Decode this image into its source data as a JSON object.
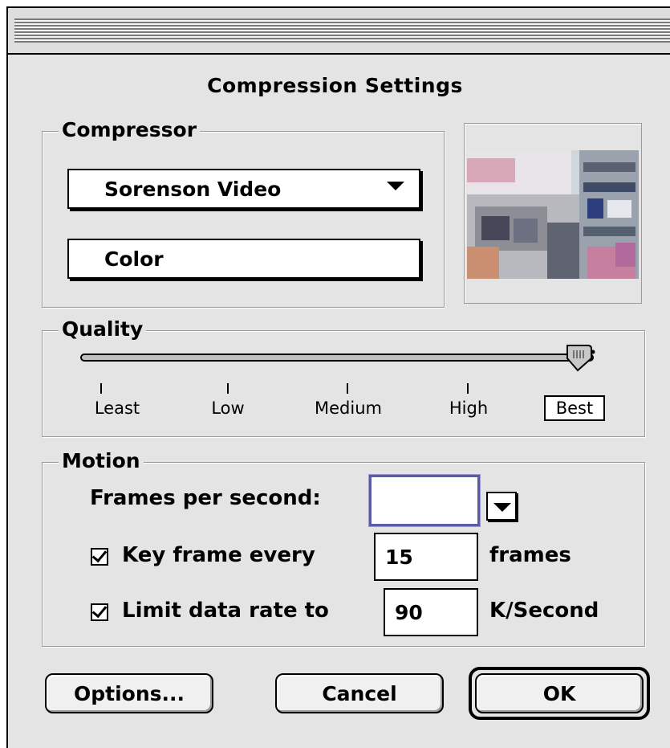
{
  "dialog": {
    "title": "Compression Settings"
  },
  "compressor": {
    "group_label": "Compressor",
    "codec_value": "Sorenson Video",
    "depth_value": "Color"
  },
  "quality": {
    "group_label": "Quality",
    "level_fraction": 1.0,
    "levels": [
      "Least",
      "Low",
      "Medium",
      "High",
      "Best"
    ],
    "selected_level": "Best"
  },
  "motion": {
    "group_label": "Motion",
    "fps_label": "Frames per second:",
    "fps_value": "",
    "keyframe": {
      "checked": true,
      "label": "Key frame every",
      "value": "15",
      "unit": "frames"
    },
    "datarate": {
      "checked": true,
      "label": "Limit data rate to",
      "value": "90",
      "unit": "K/Second"
    }
  },
  "buttons": {
    "options": "Options...",
    "cancel": "Cancel",
    "ok": "OK"
  },
  "colors": {
    "dialog_bg": "#e4e4e4",
    "focus_ring": "#5a5aa8"
  }
}
